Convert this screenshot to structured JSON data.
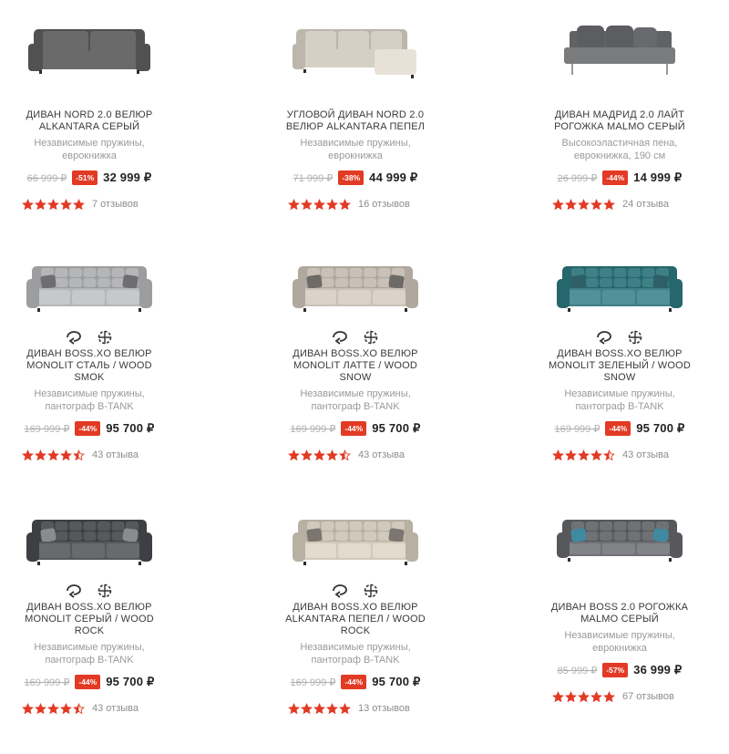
{
  "colors": {
    "accent": "#e23a24",
    "star": "#e23a24"
  },
  "products": [
    {
      "sofa": {
        "type": "straight",
        "color": "#6b6a6b",
        "cushions": "back-flat",
        "pillows": []
      },
      "icons": [],
      "title": "ДИВАН NORD 2.0 ВЕЛЮР ALKANTARA СЕРЫЙ",
      "desc": "Независимые пружины, еврокнижка",
      "old_price": "66 999 ₽",
      "discount": "-51%",
      "price": "32 999 ₽",
      "rating": 5,
      "reviews": "7 отзывов"
    },
    {
      "sofa": {
        "type": "corner",
        "color": "#d6cfc6",
        "cushions": "back-flat",
        "pillows": []
      },
      "icons": [],
      "title": "УГЛОВОЙ ДИВАН NORD 2.0 ВЕЛЮР ALKANTARA ПЕПЕЛ",
      "desc": "Независимые пружины, еврокнижка",
      "old_price": "71 999 ₽",
      "discount": "-38%",
      "price": "44 999 ₽",
      "rating": 5,
      "reviews": "16 отзывов"
    },
    {
      "sofa": {
        "type": "armless",
        "color": "#7a7b7d",
        "cushions": "pillows",
        "pillows": [
          "#5c5d60"
        ]
      },
      "icons": [],
      "title": "ДИВАН МАДРИД 2.0 ЛАЙТ РОГОЖКА MALMO СЕРЫЙ",
      "desc": "Высокоэластичная пена, еврокнижка, 190 см",
      "old_price": "26 999 ₽",
      "discount": "-44%",
      "price": "14 999 ₽",
      "rating": 5,
      "reviews": "24 отзыва"
    },
    {
      "sofa": {
        "type": "quilted",
        "color": "#b5b6b8",
        "cushions": "quilted",
        "pillows": [
          "#6e6e70"
        ]
      },
      "icons": [
        "rotate-icon",
        "modules-icon"
      ],
      "title": "ДИВАН BOSS.XO ВЕЛЮР MONOLIT СТАЛЬ / WOOD SMOK",
      "desc": "Независимые пружины, пантограф B-TANK",
      "old_price": "169 999 ₽",
      "discount": "-44%",
      "price": "95 700 ₽",
      "rating": 4.5,
      "reviews": "43 отзыва"
    },
    {
      "sofa": {
        "type": "quilted",
        "color": "#c9c1b7",
        "cushions": "quilted",
        "pillows": [
          "#6e6a66"
        ]
      },
      "icons": [
        "rotate-icon",
        "modules-icon"
      ],
      "title": "ДИВАН BOSS.XO ВЕЛЮР MONOLIT ЛАТТЕ / WOOD SNOW",
      "desc": "Независимые пружины, пантограф B-TANK",
      "old_price": "169 999 ₽",
      "discount": "-44%",
      "price": "95 700 ₽",
      "rating": 4.5,
      "reviews": "43 отзыва"
    },
    {
      "sofa": {
        "type": "quilted",
        "color": "#3f7f86",
        "cushions": "quilted",
        "pillows": [
          "#2f5f66"
        ]
      },
      "icons": [
        "rotate-icon",
        "modules-icon"
      ],
      "title": "ДИВАН BOSS.XO ВЕЛЮР MONOLIT ЗЕЛЕНЫЙ / WOOD SNOW",
      "desc": "Независимые пружины, пантограф B-TANK",
      "old_price": "169 999 ₽",
      "discount": "-44%",
      "price": "95 700 ₽",
      "rating": 4.5,
      "reviews": "43 отзыва"
    },
    {
      "sofa": {
        "type": "quilted",
        "color": "#57585b",
        "cushions": "quilted",
        "pillows": [
          "#8a8b8d"
        ]
      },
      "icons": [
        "rotate-icon",
        "modules-icon"
      ],
      "title": "ДИВАН BOSS.XO ВЕЛЮР MONOLIT СЕРЫЙ / WOOD ROCK",
      "desc": "Независимые пружины, пантограф B-TANK",
      "old_price": "169 999 ₽",
      "discount": "-44%",
      "price": "95 700 ₽",
      "rating": 4.5,
      "reviews": "43 отзыва"
    },
    {
      "sofa": {
        "type": "quilted",
        "color": "#d2c9bd",
        "cushions": "quilted",
        "pillows": [
          "#7b766f"
        ]
      },
      "icons": [
        "rotate-icon",
        "modules-icon"
      ],
      "title": "ДИВАН BOSS.XO ВЕЛЮР ALKANTARA ПЕПЕЛ / WOOD ROCK",
      "desc": "Независимые пружины, пантограф B-TANK",
      "old_price": "169 999 ₽",
      "discount": "-44%",
      "price": "95 700 ₽",
      "rating": 5,
      "reviews": "13 отзывов"
    },
    {
      "sofa": {
        "type": "quilted-low",
        "color": "#6f7175",
        "cushions": "quilted",
        "pillows": [
          "#3f8aa0"
        ]
      },
      "icons": [],
      "title": "ДИВАН BOSS 2.0 РОГОЖКА MALMO СЕРЫЙ",
      "desc": "Независимые пружины, еврокнижка",
      "old_price": "85 999 ₽",
      "discount": "-57%",
      "price": "36 999 ₽",
      "rating": 5,
      "reviews": "67 отзывов"
    }
  ]
}
